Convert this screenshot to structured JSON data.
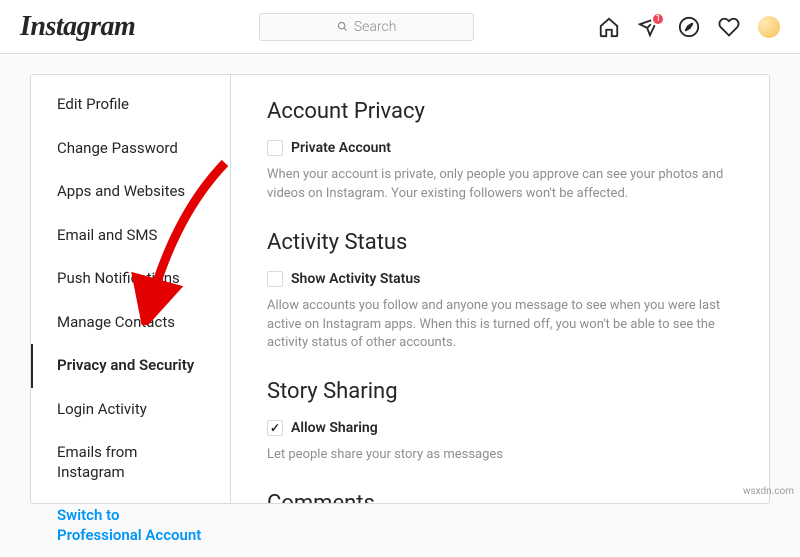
{
  "header": {
    "logo": "Instagram",
    "search_placeholder": "Search",
    "badge": "1"
  },
  "sidebar": {
    "items": [
      {
        "label": "Edit Profile"
      },
      {
        "label": "Change Password"
      },
      {
        "label": "Apps and Websites"
      },
      {
        "label": "Email and SMS"
      },
      {
        "label": "Push Notifications"
      },
      {
        "label": "Manage Contacts"
      },
      {
        "label": "Privacy and Security"
      },
      {
        "label": "Login Activity"
      },
      {
        "label": "Emails from Instagram"
      }
    ],
    "switch_label": "Switch to Professional Account"
  },
  "sections": {
    "privacy": {
      "title": "Account Privacy",
      "checkbox_label": "Private Account",
      "help": "When your account is private, only people you approve can see your photos and videos on Instagram. Your existing followers won't be affected."
    },
    "activity": {
      "title": "Activity Status",
      "checkbox_label": "Show Activity Status",
      "help": "Allow accounts you follow and anyone you message to see when you were last active on Instagram apps. When this is turned off, you won't be able to see the activity status of other accounts."
    },
    "story": {
      "title": "Story Sharing",
      "checkbox_label": "Allow Sharing",
      "help": "Let people share your story as messages"
    },
    "comments": {
      "title": "Comments"
    }
  },
  "watermark": "wsxdn.com"
}
